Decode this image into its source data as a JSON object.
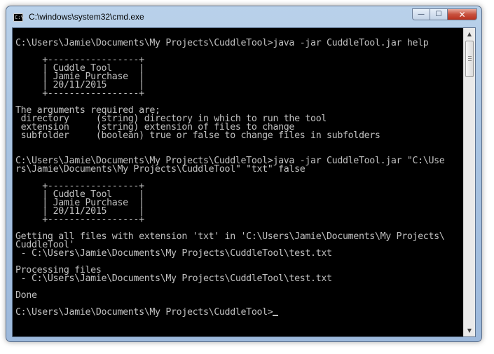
{
  "window": {
    "title": "C:\\windows\\system32\\cmd.exe",
    "icon_text": "C:\\"
  },
  "caption_buttons": {
    "minimize": "—",
    "maximize": "☐",
    "close": "✕"
  },
  "console": {
    "lines": [
      "",
      "C:\\Users\\Jamie\\Documents\\My Projects\\CuddleTool>java -jar CuddleTool.jar help",
      "",
      "     +-----------------+",
      "     | Cuddle Tool     |",
      "     | Jamie Purchase  |",
      "     | 20/11/2015      |",
      "     +-----------------+",
      "",
      "The arguments required are;",
      " directory     (string) directory in which to run the tool",
      " extension     (string) extension of files to change",
      " subfolder     (boolean) true or false to change files in subfolders",
      "",
      "",
      "C:\\Users\\Jamie\\Documents\\My Projects\\CuddleTool>java -jar CuddleTool.jar \"C:\\Use",
      "rs\\Jamie\\Documents\\My Projects\\CuddleTool\" \"txt\" false",
      "",
      "     +-----------------+",
      "     | Cuddle Tool     |",
      "     | Jamie Purchase  |",
      "     | 20/11/2015      |",
      "     +-----------------+",
      "",
      "Getting all files with extension 'txt' in 'C:\\Users\\Jamie\\Documents\\My Projects\\",
      "CuddleTool'",
      " - C:\\Users\\Jamie\\Documents\\My Projects\\CuddleTool\\test.txt",
      "",
      "Processing files",
      " - C:\\Users\\Jamie\\Documents\\My Projects\\CuddleTool\\test.txt",
      "",
      "Done",
      "",
      "C:\\Users\\Jamie\\Documents\\My Projects\\CuddleTool>"
    ]
  },
  "scrollbar": {
    "up_arrow": "▲",
    "down_arrow": "▼"
  }
}
